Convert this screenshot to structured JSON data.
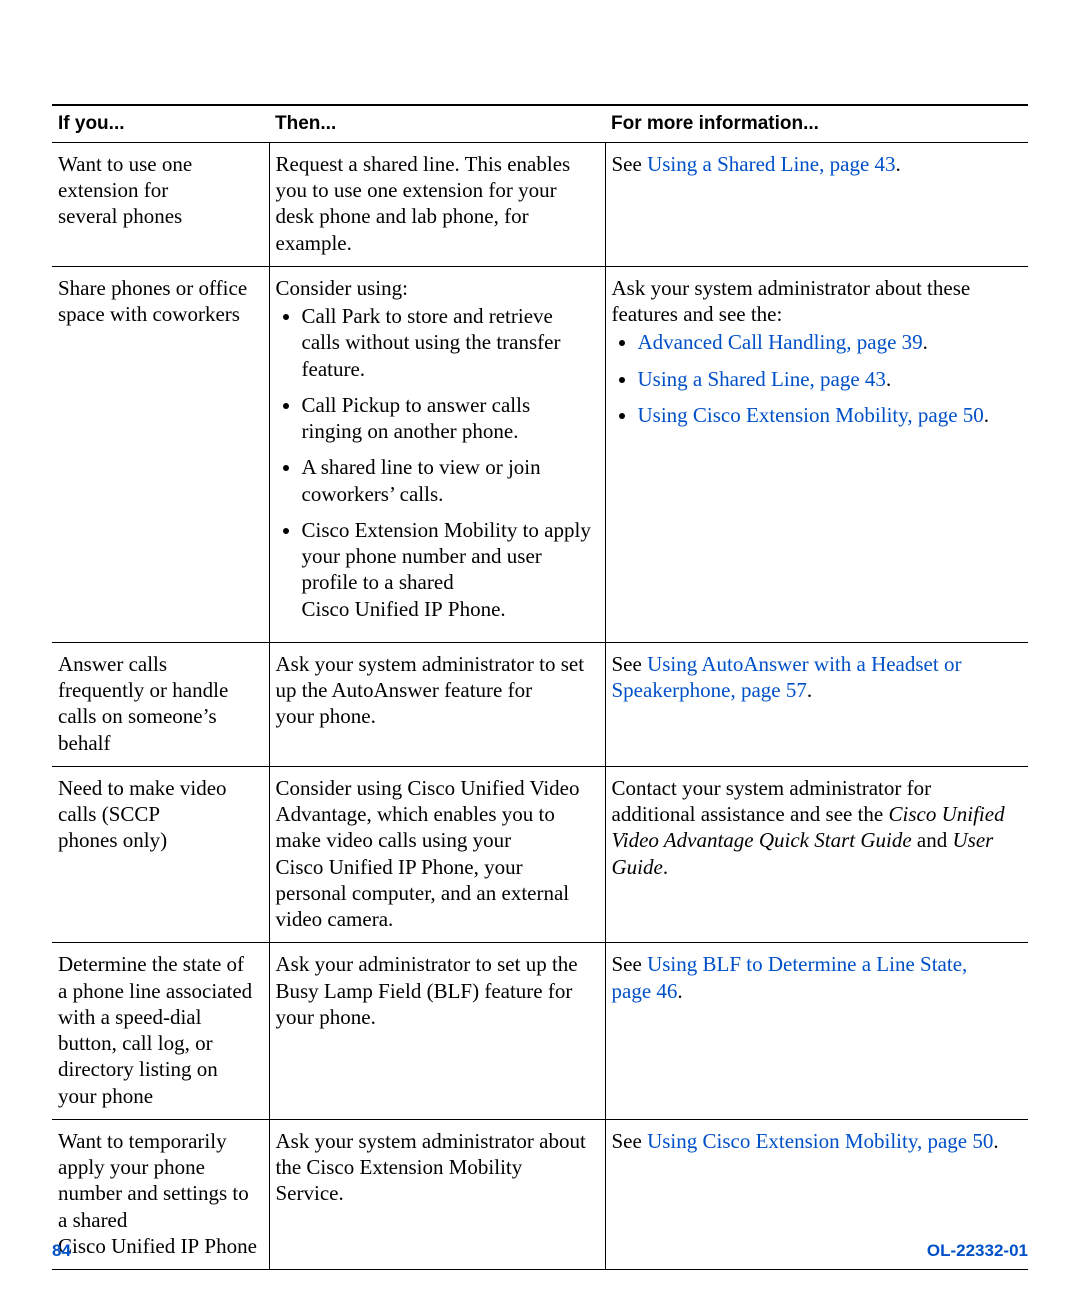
{
  "headers": {
    "col1": "If you...",
    "col2": "Then...",
    "col3": "For more information..."
  },
  "rows": [
    {
      "if_you": "Want to use one extension for several phones",
      "then": {
        "intro": "Request a shared line. This enables you to use one extension for your desk phone and lab phone, for example."
      },
      "more": {
        "before": "See ",
        "link": "Using a Shared Line, page 43",
        "after": "."
      }
    },
    {
      "if_you": "Share phones or office space with coworkers",
      "then": {
        "intro": "Consider using:",
        "bullets": [
          "Call Park to store and retrieve calls without using the transfer feature.",
          "Call Pickup to answer calls ringing on another phone.",
          "A shared line to view or join coworkers’ calls.",
          "Cisco Extension Mobility to apply your phone number and user profile to a shared Cisco Unified IP Phone."
        ]
      },
      "more": {
        "intro": "Ask your system administrator about these features and see the:",
        "link_bullets": [
          {
            "text": "Advanced Call Handling, page 39",
            "after": "."
          },
          {
            "text": "Using a Shared Line, page 43",
            "after": "."
          },
          {
            "text": "Using Cisco Extension Mobility, page 50",
            "after": "."
          }
        ]
      }
    },
    {
      "if_you": "Answer calls frequently or handle calls on someone’s behalf",
      "then": {
        "intro": "Ask your system administrator to set up the AutoAnswer feature for your phone."
      },
      "more": {
        "before": "See ",
        "link": "Using AutoAnswer with a Headset or Speakerphone, page 57",
        "after": "."
      }
    },
    {
      "if_you": "Need to make video calls (SCCP phones only)",
      "then": {
        "intro": "Consider using Cisco Unified Video Advantage, which enables you to make video calls using your Cisco Unified IP Phone, your personal computer, and an external video camera."
      },
      "more": {
        "rich": {
          "pre": "Contact your system administrator for additional assistance and see the ",
          "ital1": "Cisco Unified Video Advantage Quick Start Guide",
          "mid": " and ",
          "ital2": "User Guide",
          "post": "."
        }
      }
    },
    {
      "if_you": "Determine the state of a phone line associated with a speed-dial button, call log, or directory listing on your phone",
      "then": {
        "intro": "Ask your administrator to set up the Busy Lamp Field (BLF) feature for your phone."
      },
      "more": {
        "before": "See ",
        "link": "Using BLF to Determine a Line State, page 46",
        "after": "."
      }
    },
    {
      "if_you": "Want to temporarily apply your phone number and settings to a shared Cisco Unified IP Phone",
      "then": {
        "intro": "Ask your system administrator about the Cisco Extension Mobility Service."
      },
      "more": {
        "before": "See ",
        "link": "Using Cisco Extension Mobility, page 50",
        "after": "."
      }
    }
  ],
  "footer": {
    "page_num": "84",
    "doc_id": "OL-22332-01"
  }
}
